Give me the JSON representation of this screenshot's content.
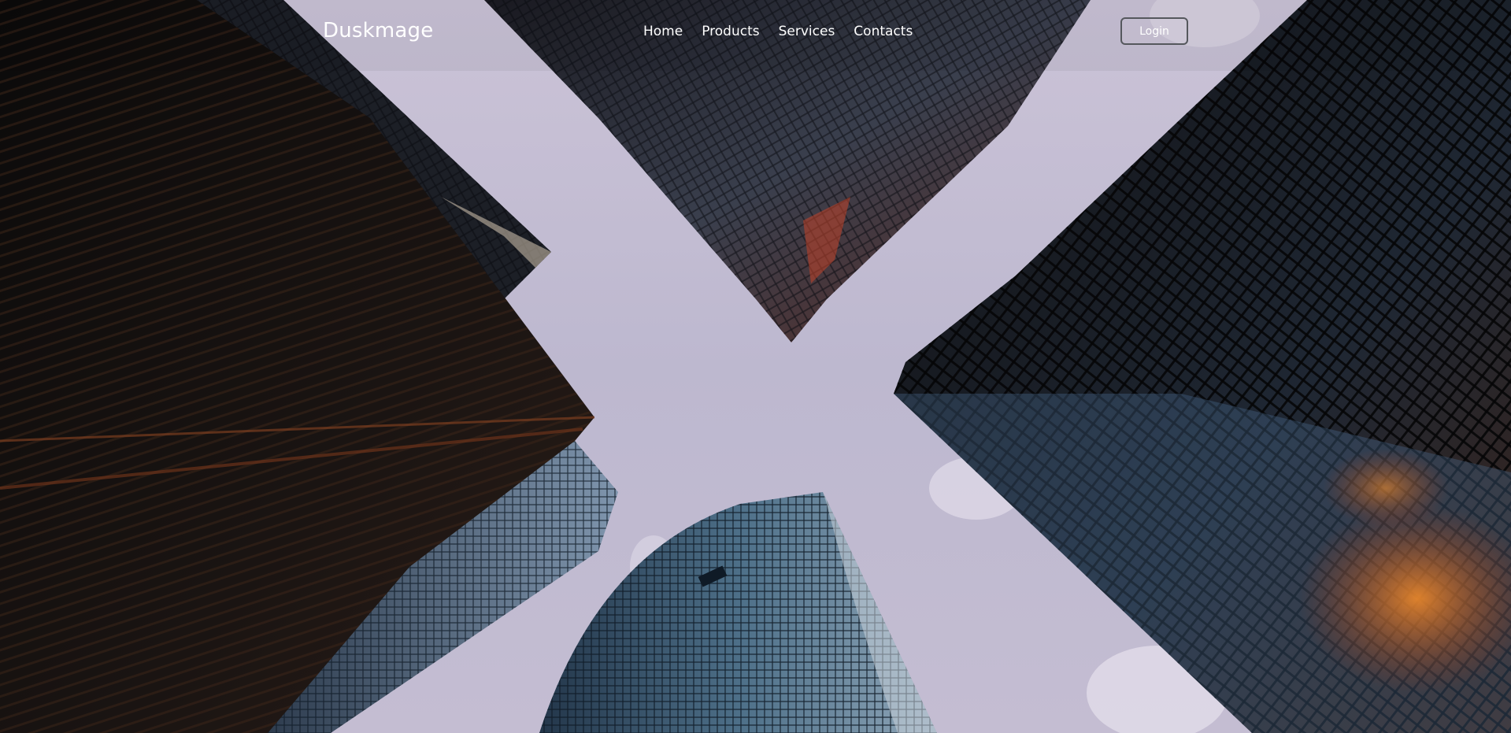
{
  "brand": {
    "name": "Duskmage"
  },
  "nav": {
    "items": [
      {
        "label": "Home"
      },
      {
        "label": "Products"
      },
      {
        "label": "Services"
      },
      {
        "label": "Contacts"
      }
    ]
  },
  "actions": {
    "login_label": "Login"
  },
  "colors": {
    "sky_top": "#c9c2d6",
    "sky_bottom": "#b9b6cd",
    "building_dark": "#0f0d0d",
    "glass_blue": "#4a6f92",
    "warm_reflection": "#b24a22",
    "text": "#ffffff",
    "button_border": "#55585d"
  }
}
